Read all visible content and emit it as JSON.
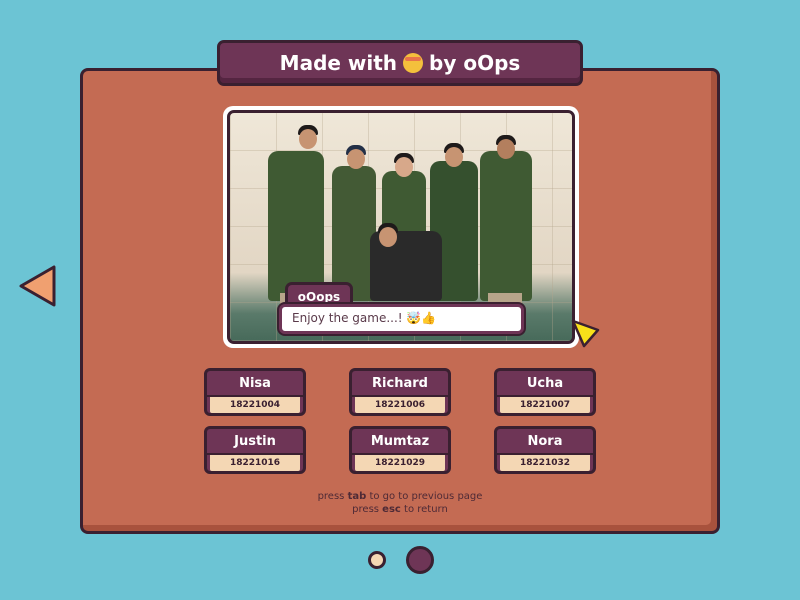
{
  "header": {
    "title_prefix": "Made with",
    "title_emoji": "mind-blown-emoji",
    "title_suffix": "by oOps"
  },
  "photo": {
    "description_icon": "team-photo",
    "chat": {
      "speaker": "oOops",
      "message": "Enjoy the game...! 🤯👍"
    }
  },
  "members": [
    {
      "name": "Nisa",
      "id": "18221004"
    },
    {
      "name": "Richard",
      "id": "18221006"
    },
    {
      "name": "Ucha",
      "id": "18221007"
    },
    {
      "name": "Justin",
      "id": "18221016"
    },
    {
      "name": "Mumtaz",
      "id": "18221029"
    },
    {
      "name": "Nora",
      "id": "18221032"
    }
  ],
  "hints": {
    "line1_pre": "press",
    "line1_key": "tab",
    "line1_post": "to go to previous page",
    "line2_pre": "press",
    "line2_key": "esc",
    "line2_post": "to return"
  },
  "pagination": {
    "current_page": 2,
    "total_pages": 2
  },
  "colors": {
    "background": "#6cc4d4",
    "board": "#c46b53",
    "plate": "#6e3556",
    "outline": "#3a2030",
    "badge": "#f4d7b4",
    "arrow_left": "#f0a070",
    "cursor": "#f7e01a"
  }
}
